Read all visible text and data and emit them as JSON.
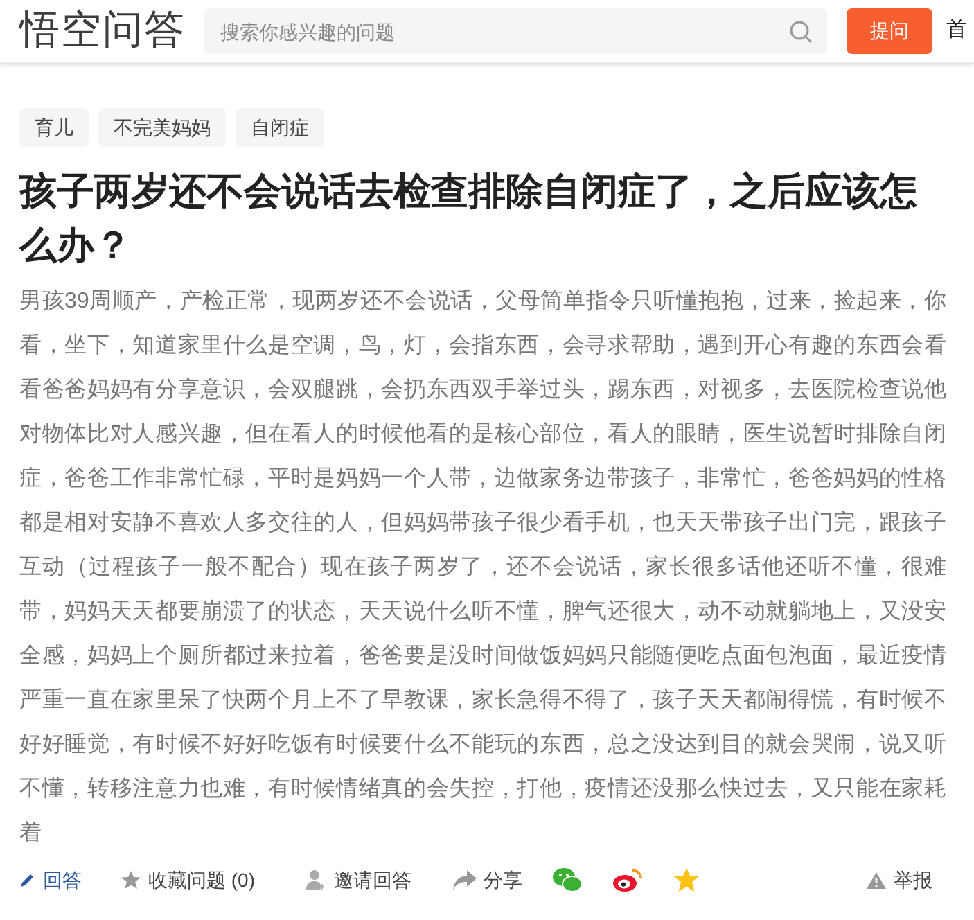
{
  "header": {
    "logo": "悟空问答",
    "search": {
      "placeholder": "搜索你感兴趣的问题"
    },
    "ask_button": "提问",
    "nav_item": "首"
  },
  "tags": [
    "育儿",
    "不完美妈妈",
    "自闭症"
  ],
  "question": {
    "title": "孩子两岁还不会说话去检查排除自闭症了，之后应该怎么办？",
    "body": "男孩39周顺产，产检正常，现两岁还不会说话，父母简单指令只听懂抱抱，过来，捡起来，你看，坐下，知道家里什么是空调，鸟，灯，会指东西，会寻求帮助，遇到开心有趣的东西会看看爸爸妈妈有分享意识，会双腿跳，会扔东西双手举过头，踢东西，对视多，去医院检查说他对物体比对人感兴趣，但在看人的时候他看的是核心部位，看人的眼睛，医生说暂时排除自闭症，爸爸工作非常忙碌，平时是妈妈一个人带，边做家务边带孩子，非常忙，爸爸妈妈的性格都是相对安静不喜欢人多交往的人，但妈妈带孩子很少看手机，也天天带孩子出门完，跟孩子互动（过程孩子一般不配合）现在孩子两岁了，还不会说话，家长很多话他还听不懂，很难带，妈妈天天都要崩溃了的状态，天天说什么听不懂，脾气还很大，动不动就躺地上，又没安全感，妈妈上个厕所都过来拉着，爸爸要是没时间做饭妈妈只能随便吃点面包泡面，最近疫情严重一直在家里呆了快两个月上不了早教课，家长急得不得了，孩子天天都闹得慌，有时候不好好睡觉，有时候不好好吃饭有时候要什么不能玩的东西，总之没达到目的就会哭闹，说又听不懂，转移注意力也难，有时候情绪真的会失控，打他，疫情还没那么快过去，又只能在家耗着"
  },
  "actions": [
    {
      "kind": "answer",
      "label": "回答"
    },
    {
      "kind": "collect",
      "label": "收藏问题 (0)"
    },
    {
      "kind": "invite",
      "label": "邀请回答"
    },
    {
      "kind": "share",
      "label": "分享"
    },
    {
      "kind": "wechat"
    },
    {
      "kind": "weibo"
    },
    {
      "kind": "qzone"
    },
    {
      "kind": "report",
      "label": "举报"
    }
  ]
}
